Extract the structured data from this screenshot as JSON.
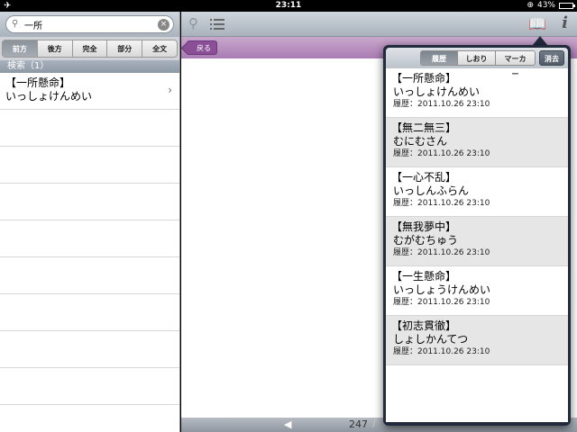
{
  "status_bar": {
    "time": "23:11",
    "airplane_icon": "✈",
    "lock_icon": "⊕",
    "battery_text": "43%",
    "battery_level": 0.43
  },
  "left_panel": {
    "search": {
      "value": "一所",
      "placeholder": ""
    },
    "mode_tabs": [
      {
        "label": "前方",
        "active": true
      },
      {
        "label": "後方",
        "active": false
      },
      {
        "label": "完全",
        "active": false
      },
      {
        "label": "部分",
        "active": false
      },
      {
        "label": "全文",
        "active": false
      }
    ],
    "section_header": "検索（1）",
    "results": [
      {
        "word": "【一所懸命】",
        "reading": "いっしょけんめい"
      }
    ]
  },
  "main": {
    "back_label": "戻る",
    "page_current": "247",
    "page_sep": "/"
  },
  "popover": {
    "tabs": [
      {
        "label": "履歴",
        "active": true
      },
      {
        "label": "しおり",
        "active": false
      },
      {
        "label": "マーカー",
        "active": false
      }
    ],
    "clear_label": "消去",
    "items": [
      {
        "word": "【一所懸命】",
        "reading": "いっしょけんめい",
        "history": "履歴：2011.10.26 23:10"
      },
      {
        "word": "【無二無三】",
        "reading": "むにむさん",
        "history": "履歴：2011.10.26 23:10"
      },
      {
        "word": "【一心不乱】",
        "reading": "いっしんふらん",
        "history": "履歴：2011.10.26 23:10"
      },
      {
        "word": "【無我夢中】",
        "reading": "むがむちゅう",
        "history": "履歴：2011.10.26 23:10"
      },
      {
        "word": "【一生懸命】",
        "reading": "いっしょうけんめい",
        "history": "履歴：2011.10.26 23:10"
      },
      {
        "word": "【初志貫徹】",
        "reading": "しょしかんてつ",
        "history": "履歴：2011.10.26 23:10"
      }
    ]
  }
}
